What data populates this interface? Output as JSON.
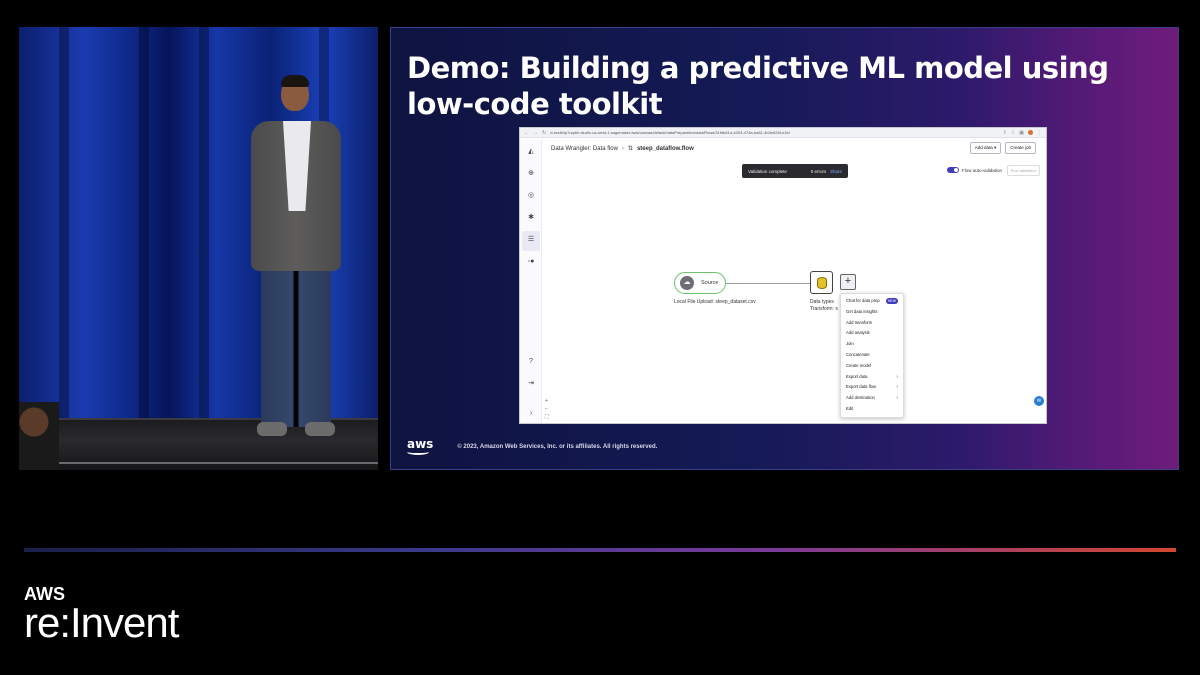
{
  "slide": {
    "title": "Demo: Building a predictive ML model using low-code toolkit",
    "footer_logo": "aws",
    "copyright": "© 2023, Amazon Web Services, Inc. or its affiliates. All rights reserved."
  },
  "browser": {
    "url": "d-rmdkhp7uqrkh.studio.us-west-1.sagemaker.aws/canvas/default/dataPreparation/dataFlows/31fdb61d-4093-474a-ba61-4b3e6261e1fd",
    "breadcrumb": [
      "Data Wrangler: Data flow",
      "steep_dataflow.flow"
    ],
    "add_data_label": "Add data",
    "create_job_label": "Create job",
    "validation": {
      "status": "Validation complete",
      "errors": "0 errors",
      "share": "Share"
    },
    "flow_auto_validation_label": "Flow auto-validation",
    "run_validation_label": "Run validation",
    "source_node_label": "Source",
    "source_caption": "Local File Upload: steep_dataset.csv",
    "dtypes_caption_1": "Data types",
    "dtypes_caption_2": "Transform: s",
    "menu_items": [
      {
        "label": "Chat for data prep",
        "badge": "NEW"
      },
      {
        "label": "Get data insights"
      },
      {
        "label": "Add transform"
      },
      {
        "label": "Add analysis"
      },
      {
        "label": "Join"
      },
      {
        "label": "Concatenate"
      },
      {
        "label": "Create model"
      },
      {
        "label": "Export data",
        "arrow": "›"
      },
      {
        "label": "Export data flow",
        "arrow": "›"
      },
      {
        "label": "Add destination",
        "arrow": "›"
      },
      {
        "label": "Edit"
      }
    ]
  },
  "brand": {
    "aws": "AWS",
    "event": "re:Invent"
  }
}
